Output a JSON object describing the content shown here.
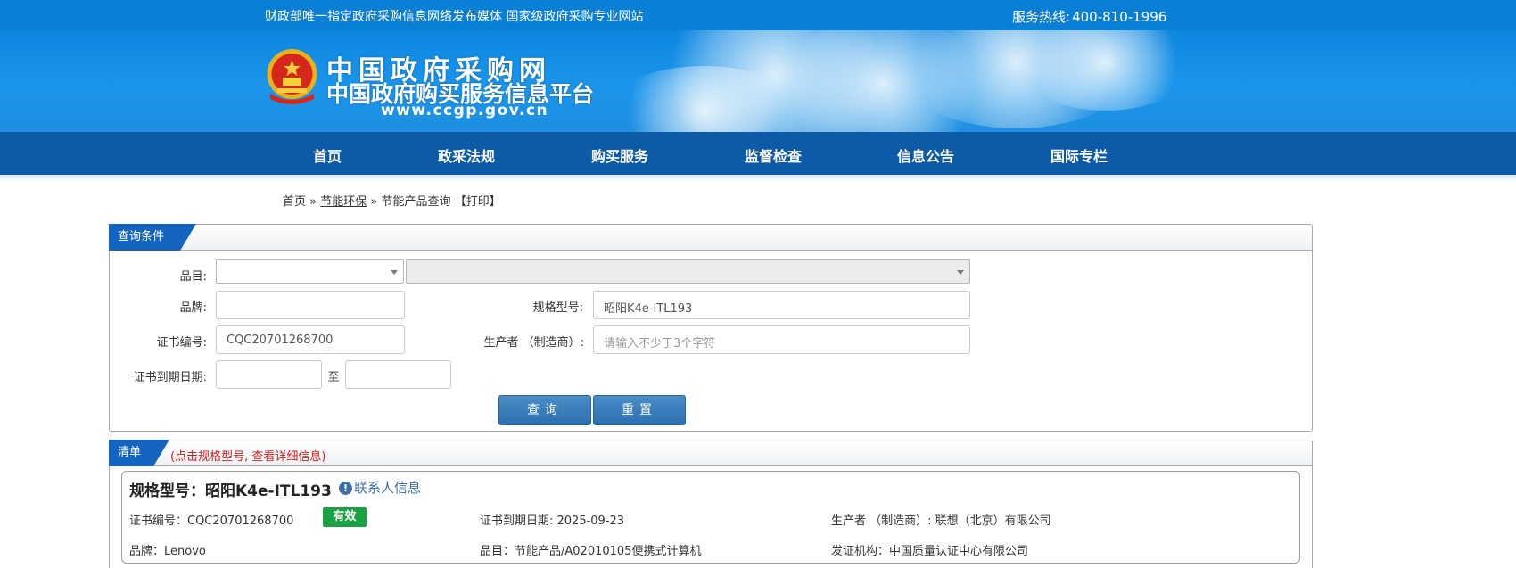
{
  "topbar": {
    "slogan": "财政部唯一指定政府采购信息网络发布媒体 国家级政府采购专业网站",
    "hotline_label": "服务热线:",
    "hotline_number": "400-810-1996"
  },
  "logo": {
    "line1": "中国政府采购网",
    "line2": "中国政府购买服务信息平台",
    "url": "www.ccgp.gov.cn"
  },
  "nav": [
    "首页",
    "政采法规",
    "购买服务",
    "监督检查",
    "信息公告",
    "国际专栏"
  ],
  "breadcrumb": {
    "home": "首页",
    "sep1": "»",
    "section": "节能环保",
    "sep2": "»",
    "current": "节能产品查询",
    "print": "【打印】"
  },
  "query": {
    "tab": "查询条件",
    "category_label": "品目:",
    "category_value": "",
    "subcategory_value": "",
    "brand_label": "品牌:",
    "brand_value": "",
    "model_label": "规格型号:",
    "model_value": "昭阳K4e-ITL193",
    "cert_label": "证书编号:",
    "cert_value": "CQC20701268700",
    "maker_label": "生产者 （制造商）:",
    "maker_placeholder": "请输入不少于3个字符",
    "expiry_label": "证书到期日期:",
    "expiry_from": "",
    "expiry_to_label": "至",
    "expiry_to": "",
    "search_button": "查询",
    "reset_button": "重置"
  },
  "list": {
    "tab": "清单",
    "hint": "(点击规格型号, 查看详细信息)",
    "items": [
      {
        "title": "规格型号：昭阳K4e-ITL193",
        "contact": "联系人信息",
        "cert_no": "证书编号：CQC20701268700",
        "status": "有效",
        "expiry": "证书到期日期: 2025-09-23",
        "maker": "生产者 （制造商）: 联想（北京）有限公司",
        "brand": "品牌：Lenovo",
        "category": "品目：节能产品/A02010105便携式计算机",
        "issuer": "发证机构：中国质量认证中心有限公司"
      }
    ]
  },
  "colors": {
    "topbar": "#0a7fd6",
    "nav": "#0d5aa7",
    "tab": "#1565c0",
    "button": "#2d6fae",
    "valid_badge": "#1aa142",
    "hint": "#d21c1c"
  }
}
